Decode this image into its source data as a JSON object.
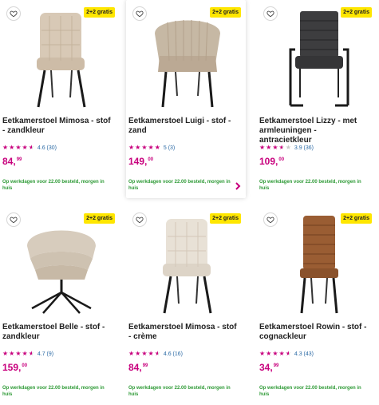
{
  "products": [
    {
      "title": "Eetkamerstoel Mimosa - stof - zandkleur",
      "badge": "2+2 gratis",
      "rating": 4.6,
      "rating_count": "4.6 (30)",
      "price_main": "84,",
      "price_cents": "99",
      "delivery": "Op werkdagen voor 22.00 besteld, morgen in huis",
      "image": "mimosa-chair-sand",
      "highlighted": false,
      "stars": [
        "full",
        "full",
        "full",
        "full",
        "half"
      ]
    },
    {
      "title": "Eetkamerstoel Luigi - stof - zand",
      "badge": "2+2 gratis",
      "rating": 5.0,
      "rating_count": "5 (3)",
      "price_main": "149,",
      "price_cents": "00",
      "delivery": "Op werkdagen voor 22.00 besteld, morgen in huis",
      "image": "luigi-chair-sand",
      "highlighted": true,
      "stars": [
        "full",
        "full",
        "full",
        "full",
        "full"
      ]
    },
    {
      "title": "Eetkamerstoel Lizzy - met armleuningen - antracietkleur",
      "badge": "2+2 gratis",
      "rating": 3.9,
      "rating_count": "3.9 (36)",
      "price_main": "109,",
      "price_cents": "00",
      "delivery": "Op werkdagen voor 22.00 besteld, morgen in huis",
      "image": "lizzy-chair-anthracite",
      "highlighted": false,
      "stars": [
        "full",
        "full",
        "full",
        "half",
        "empty"
      ]
    },
    {
      "title": "Eetkamerstoel Belle - stof - zandkleur",
      "badge": "2+2 gratis",
      "rating": 4.7,
      "rating_count": "4.7 (9)",
      "price_main": "159,",
      "price_cents": "00",
      "delivery": "Op werkdagen voor 22.00 besteld, morgen in huis",
      "image": "belle-chair-sand",
      "highlighted": false,
      "stars": [
        "full",
        "full",
        "full",
        "full",
        "half"
      ]
    },
    {
      "title": "Eetkamerstoel Mimosa - stof - crème",
      "badge": "2+2 gratis",
      "rating": 4.6,
      "rating_count": "4.6 (16)",
      "price_main": "84,",
      "price_cents": "99",
      "delivery": "Op werkdagen voor 22.00 besteld, morgen in huis",
      "image": "mimosa-chair-cream",
      "highlighted": false,
      "stars": [
        "full",
        "full",
        "full",
        "full",
        "half"
      ]
    },
    {
      "title": "Eetkamerstoel Rowin - stof - cognackleur",
      "badge": "2+2 gratis",
      "rating": 4.3,
      "rating_count": "4.3 (43)",
      "price_main": "34,",
      "price_cents": "99",
      "delivery": "Op werkdagen voor 22.00 besteld, morgen in huis",
      "image": "rowin-chair-cognac",
      "highlighted": false,
      "stars": [
        "full",
        "full",
        "full",
        "full",
        "half"
      ]
    }
  ],
  "colors": {
    "price": "#c8007d",
    "star": "#c8007d",
    "delivery": "#2e9a36",
    "badge_bg": "#ffe600",
    "link": "#2b6aa5"
  },
  "icons": {
    "wishlist": "heart-outline-icon",
    "next": "chevron-right-icon",
    "star": "star-icon"
  }
}
